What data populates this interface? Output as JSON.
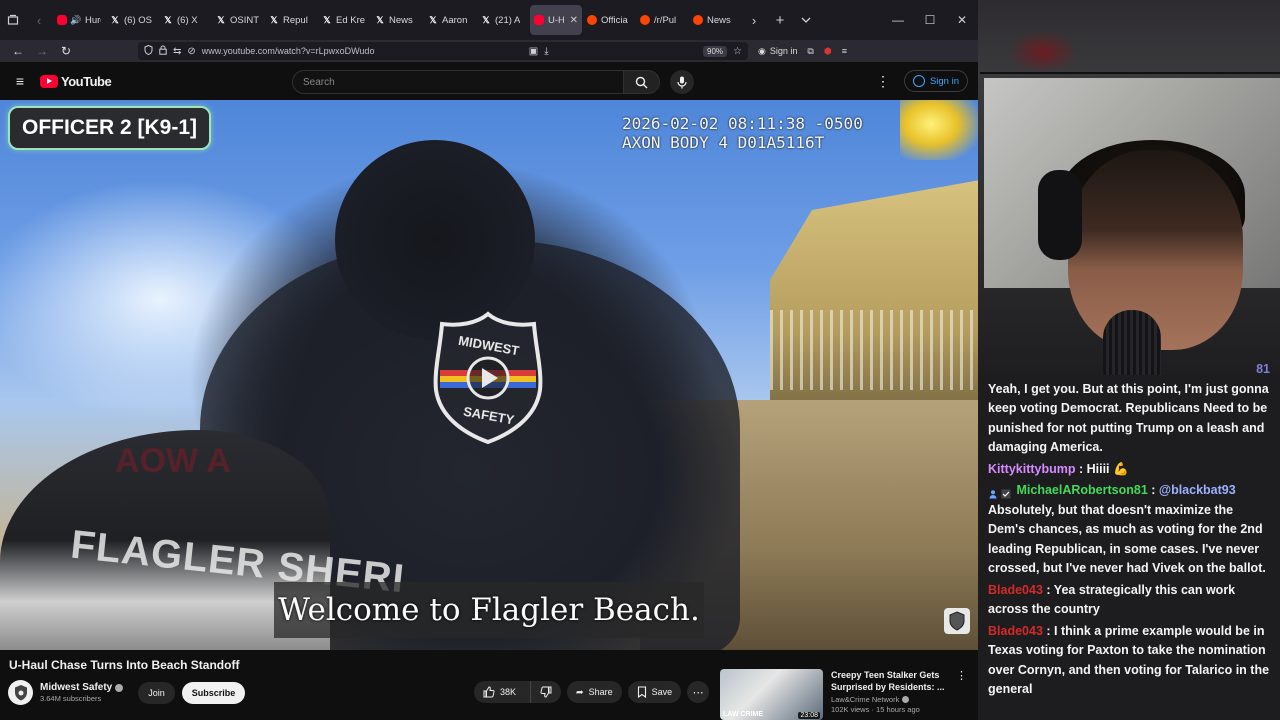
{
  "browser": {
    "tabs": [
      {
        "label": "Hurdy",
        "icon": "youtube-audio",
        "active": false
      },
      {
        "label": "(6) OS",
        "icon": "x",
        "active": false
      },
      {
        "label": "(6) X",
        "icon": "x",
        "active": false
      },
      {
        "label": "OSINT",
        "icon": "x",
        "active": false
      },
      {
        "label": "Repul",
        "icon": "x",
        "active": false
      },
      {
        "label": "Ed Kre",
        "icon": "x",
        "active": false
      },
      {
        "label": "News",
        "icon": "x",
        "active": false
      },
      {
        "label": "Aaron",
        "icon": "x",
        "active": false
      },
      {
        "label": "(21) A",
        "icon": "x",
        "active": false
      },
      {
        "label": "U-H",
        "icon": "youtube",
        "active": true
      },
      {
        "label": "Officia",
        "icon": "reddit",
        "active": false
      },
      {
        "label": "/r/Pul",
        "icon": "reddit",
        "active": false
      },
      {
        "label": "News",
        "icon": "reddit",
        "active": false
      }
    ],
    "url": "www.youtube.com/watch?v=rLpwxoDWudo",
    "zoom": "90%",
    "signin_label": "Sign in"
  },
  "youtube": {
    "logo_text": "YouTube",
    "search_placeholder": "Search",
    "signin_label": "Sign in"
  },
  "video": {
    "overlay_badge": "OFFICER 2 [K9-1]",
    "timestamp_line1": "2026-02-02 08:11:38 -0500",
    "timestamp_line2": "AXON BODY 4 D01A5116T",
    "logo_top": "MIDWEST",
    "logo_bottom": "SAFETY",
    "car_text": "FLAGLER SHERI",
    "blur_text": "AOW A",
    "subtitle": "Welcome to Flagler Beach."
  },
  "meta": {
    "title": "U-Haul Chase Turns Into Beach Standoff",
    "channel_name": "Midwest Safety",
    "subscribers": "3.64M subscribers",
    "join_label": "Join",
    "subscribe_label": "Subscribe",
    "likes": "38K",
    "share_label": "Share",
    "save_label": "Save"
  },
  "recommended": {
    "title": "Creepy Teen Stalker Gets Surprised by Residents: ...",
    "channel": "Law&Crime Network",
    "views_time": "102K views · 15 hours ago",
    "duration": "23:08",
    "thumb_text": "LAW CRIME"
  },
  "chat": {
    "messages": [
      {
        "user": "81",
        "user_color": "faded",
        "text": "Yeah, I get you. But at this point, I'm just gonna keep voting Democrat. Republicans Need to be punished for not putting Trump on a leash and damaging America."
      },
      {
        "user": "Kittykittybump",
        "user_color": "purple",
        "text": "Hiiii 💪"
      },
      {
        "user": "MichaelARobertson81",
        "user_color": "green",
        "mention": "@blackbat93",
        "text": "Absolutely, but that doesn't maximize the Dem's chances, as much as voting for the 2nd leading Republican, in some cases. I've never crossed, but I've never had Vivek on the ballot."
      },
      {
        "user": "Blade043",
        "user_color": "red",
        "text": "Yea strategically this can work across the country"
      },
      {
        "user": "Blade043",
        "user_color": "red",
        "text": "I think a prime example would be in Texas voting for Paxton to take the nomination over Cornyn, and then voting for Talarico in the general"
      }
    ]
  },
  "colors": {
    "youtube_red": "#ff0033",
    "overlay_border": "#9ce6b8",
    "link_blue": "#3ea6ff"
  }
}
